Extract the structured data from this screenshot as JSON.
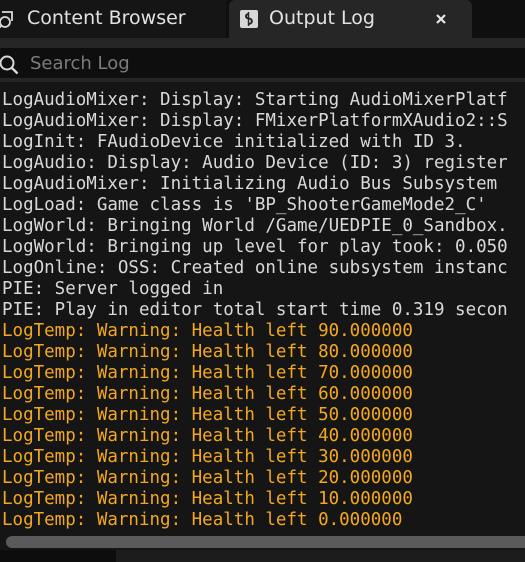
{
  "tabs": {
    "content_browser": {
      "label": "Content Browser",
      "icon": "content-browser-icon"
    },
    "output_log": {
      "label": "Output Log",
      "icon": "log-icon",
      "close_icon": "close-icon"
    }
  },
  "search": {
    "placeholder": "Search Log",
    "value": "",
    "icon": "search-icon"
  },
  "colors": {
    "background": "#151515",
    "normal_text": "#d9d9d9",
    "warning_text": "#f3a81f"
  },
  "log": {
    "lines": [
      {
        "text": "LogAudioMixer: Display: Starting AudioMixerPlatf",
        "level": "normal"
      },
      {
        "text": "LogAudioMixer: Display: FMixerPlatformXAudio2::S",
        "level": "normal"
      },
      {
        "text": "LogInit: FAudioDevice initialized with ID 3.",
        "level": "normal"
      },
      {
        "text": "LogAudio: Display: Audio Device (ID: 3) register",
        "level": "normal"
      },
      {
        "text": "LogAudioMixer: Initializing Audio Bus Subsystem",
        "level": "normal"
      },
      {
        "text": "LogLoad: Game class is 'BP_ShooterGameMode2_C'",
        "level": "normal"
      },
      {
        "text": "LogWorld: Bringing World /Game/UEDPIE_0_Sandbox.",
        "level": "normal"
      },
      {
        "text": "LogWorld: Bringing up level for play took: 0.050",
        "level": "normal"
      },
      {
        "text": "LogOnline: OSS: Created online subsystem instanc",
        "level": "normal"
      },
      {
        "text": "PIE: Server logged in",
        "level": "normal"
      },
      {
        "text": "PIE: Play in editor total start time 0.319 secon",
        "level": "normal"
      },
      {
        "text": "LogTemp: Warning: Health left 90.000000",
        "level": "warning"
      },
      {
        "text": "LogTemp: Warning: Health left 80.000000",
        "level": "warning"
      },
      {
        "text": "LogTemp: Warning: Health left 70.000000",
        "level": "warning"
      },
      {
        "text": "LogTemp: Warning: Health left 60.000000",
        "level": "warning"
      },
      {
        "text": "LogTemp: Warning: Health left 50.000000",
        "level": "warning"
      },
      {
        "text": "LogTemp: Warning: Health left 40.000000",
        "level": "warning"
      },
      {
        "text": "LogTemp: Warning: Health left 30.000000",
        "level": "warning"
      },
      {
        "text": "LogTemp: Warning: Health left 20.000000",
        "level": "warning"
      },
      {
        "text": "LogTemp: Warning: Health left 10.000000",
        "level": "warning"
      },
      {
        "text": "LogTemp: Warning: Health left 0.000000",
        "level": "warning"
      }
    ]
  }
}
